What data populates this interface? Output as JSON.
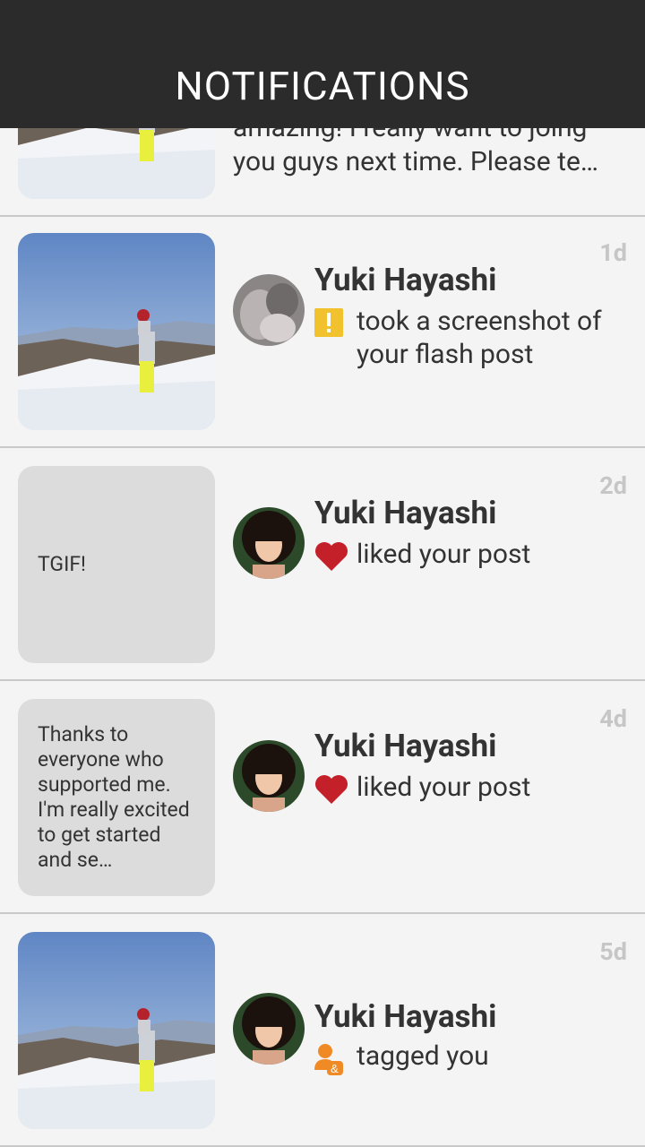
{
  "header": {
    "title": "NOTIFICATIONS"
  },
  "partial": {
    "text": "amazing! I really want to joing you guys next time. Please te…"
  },
  "notifications": [
    {
      "time": "1d",
      "name": "Yuki Hayashi",
      "action": "took a screenshot of your flash post",
      "icon": "warning-icon",
      "thumb": "snow-photo"
    },
    {
      "time": "2d",
      "name": "Yuki Hayashi",
      "action": "liked your post",
      "icon": "heart-icon",
      "thumb_text": "TGIF!"
    },
    {
      "time": "4d",
      "name": "Yuki Hayashi",
      "action": "liked your post",
      "icon": "heart-icon",
      "thumb_text": "Thanks to everyone who supported me. I'm really excited to get started and se…"
    },
    {
      "time": "5d",
      "name": "Yuki Hayashi",
      "action": "tagged you",
      "icon": "tag-person-icon",
      "thumb": "snow-photo"
    }
  ],
  "colors": {
    "header_bg": "#2b2b2b",
    "heart": "#c4202a",
    "warning": "#f2c12e",
    "tag": "#f08a24"
  }
}
